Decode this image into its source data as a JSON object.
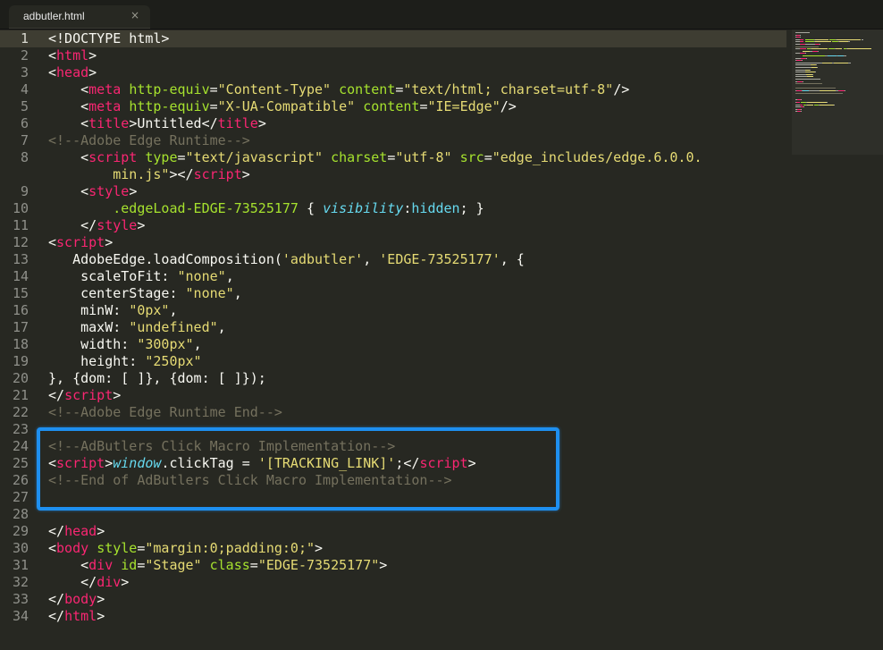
{
  "tab": {
    "title": "adbutler.html",
    "close": "×"
  },
  "code": {
    "line_numbers": [
      "1",
      "2",
      "3",
      "4",
      "5",
      "6",
      "7",
      "8",
      "",
      "9",
      "10",
      "11",
      "12",
      "13",
      "14",
      "15",
      "16",
      "17",
      "18",
      "19",
      "20",
      "21",
      "22",
      "23",
      "24",
      "25",
      "26",
      "27",
      "28",
      "29",
      "30",
      "31",
      "32",
      "33",
      "34"
    ],
    "lines": [
      [
        {
          "t": "<!DOCTYPE html>",
          "c": "plain"
        }
      ],
      [
        {
          "t": "<",
          "c": "plain"
        },
        {
          "t": "html",
          "c": "tag"
        },
        {
          "t": ">",
          "c": "plain"
        }
      ],
      [
        {
          "t": "<",
          "c": "plain"
        },
        {
          "t": "head",
          "c": "tag"
        },
        {
          "t": ">",
          "c": "plain"
        }
      ],
      [
        {
          "t": "    <",
          "c": "plain"
        },
        {
          "t": "meta",
          "c": "tag"
        },
        {
          "t": " ",
          "c": "plain"
        },
        {
          "t": "http-equiv",
          "c": "attr"
        },
        {
          "t": "=",
          "c": "plain"
        },
        {
          "t": "\"Content-Type\"",
          "c": "str"
        },
        {
          "t": " ",
          "c": "plain"
        },
        {
          "t": "content",
          "c": "attr"
        },
        {
          "t": "=",
          "c": "plain"
        },
        {
          "t": "\"text/html; charset=utf-8\"",
          "c": "str"
        },
        {
          "t": "/>",
          "c": "plain"
        }
      ],
      [
        {
          "t": "    <",
          "c": "plain"
        },
        {
          "t": "meta",
          "c": "tag"
        },
        {
          "t": " ",
          "c": "plain"
        },
        {
          "t": "http-equiv",
          "c": "attr"
        },
        {
          "t": "=",
          "c": "plain"
        },
        {
          "t": "\"X-UA-Compatible\"",
          "c": "str"
        },
        {
          "t": " ",
          "c": "plain"
        },
        {
          "t": "content",
          "c": "attr"
        },
        {
          "t": "=",
          "c": "plain"
        },
        {
          "t": "\"IE=Edge\"",
          "c": "str"
        },
        {
          "t": "/>",
          "c": "plain"
        }
      ],
      [
        {
          "t": "    <",
          "c": "plain"
        },
        {
          "t": "title",
          "c": "tag"
        },
        {
          "t": ">Untitled</",
          "c": "plain"
        },
        {
          "t": "title",
          "c": "tag"
        },
        {
          "t": ">",
          "c": "plain"
        }
      ],
      [
        {
          "t": "<!--Adobe Edge Runtime-->",
          "c": "com"
        }
      ],
      [
        {
          "t": "    <",
          "c": "plain"
        },
        {
          "t": "script",
          "c": "tag"
        },
        {
          "t": " ",
          "c": "plain"
        },
        {
          "t": "type",
          "c": "attr"
        },
        {
          "t": "=",
          "c": "plain"
        },
        {
          "t": "\"text/javascript\"",
          "c": "str"
        },
        {
          "t": " ",
          "c": "plain"
        },
        {
          "t": "charset",
          "c": "attr"
        },
        {
          "t": "=",
          "c": "plain"
        },
        {
          "t": "\"utf-8\"",
          "c": "str"
        },
        {
          "t": " ",
          "c": "plain"
        },
        {
          "t": "src",
          "c": "attr"
        },
        {
          "t": "=",
          "c": "plain"
        },
        {
          "t": "\"edge_includes/edge.6.0.0.",
          "c": "str"
        }
      ],
      [
        {
          "t": "        ",
          "c": "plain"
        },
        {
          "t": "min.js\"",
          "c": "str"
        },
        {
          "t": "></",
          "c": "plain"
        },
        {
          "t": "script",
          "c": "tag"
        },
        {
          "t": ">",
          "c": "plain"
        }
      ],
      [
        {
          "t": "    <",
          "c": "plain"
        },
        {
          "t": "style",
          "c": "tag"
        },
        {
          "t": ">",
          "c": "plain"
        }
      ],
      [
        {
          "t": "        ",
          "c": "plain"
        },
        {
          "t": ".edgeLoad-EDGE-73525177",
          "c": "attr"
        },
        {
          "t": " { ",
          "c": "plain"
        },
        {
          "t": "visibility",
          "c": "var"
        },
        {
          "t": ":",
          "c": "plain"
        },
        {
          "t": "hidden",
          "c": "kw"
        },
        {
          "t": "; }",
          "c": "plain"
        }
      ],
      [
        {
          "t": "    </",
          "c": "plain"
        },
        {
          "t": "style",
          "c": "tag"
        },
        {
          "t": ">",
          "c": "plain"
        }
      ],
      [
        {
          "t": "<",
          "c": "plain"
        },
        {
          "t": "script",
          "c": "tag"
        },
        {
          "t": ">",
          "c": "plain"
        }
      ],
      [
        {
          "t": "   AdobeEdge.loadComposition(",
          "c": "plain"
        },
        {
          "t": "'adbutler'",
          "c": "str"
        },
        {
          "t": ", ",
          "c": "plain"
        },
        {
          "t": "'EDGE-73525177'",
          "c": "str"
        },
        {
          "t": ", {",
          "c": "plain"
        }
      ],
      [
        {
          "t": "    scaleToFit: ",
          "c": "plain"
        },
        {
          "t": "\"none\"",
          "c": "str"
        },
        {
          "t": ",",
          "c": "plain"
        }
      ],
      [
        {
          "t": "    centerStage: ",
          "c": "plain"
        },
        {
          "t": "\"none\"",
          "c": "str"
        },
        {
          "t": ",",
          "c": "plain"
        }
      ],
      [
        {
          "t": "    minW: ",
          "c": "plain"
        },
        {
          "t": "\"0px\"",
          "c": "str"
        },
        {
          "t": ",",
          "c": "plain"
        }
      ],
      [
        {
          "t": "    maxW: ",
          "c": "plain"
        },
        {
          "t": "\"undefined\"",
          "c": "str"
        },
        {
          "t": ",",
          "c": "plain"
        }
      ],
      [
        {
          "t": "    width: ",
          "c": "plain"
        },
        {
          "t": "\"300px\"",
          "c": "str"
        },
        {
          "t": ",",
          "c": "plain"
        }
      ],
      [
        {
          "t": "    height: ",
          "c": "plain"
        },
        {
          "t": "\"250px\"",
          "c": "str"
        }
      ],
      [
        {
          "t": "}, {dom: [ ]}, {dom: [ ]});",
          "c": "plain"
        }
      ],
      [
        {
          "t": "</",
          "c": "plain"
        },
        {
          "t": "script",
          "c": "tag"
        },
        {
          "t": ">",
          "c": "plain"
        }
      ],
      [
        {
          "t": "<!--Adobe Edge Runtime End-->",
          "c": "com"
        }
      ],
      [
        {
          "t": "",
          "c": "plain"
        }
      ],
      [
        {
          "t": "<!--AdButlers Click Macro Implementation-->",
          "c": "com"
        }
      ],
      [
        {
          "t": "<",
          "c": "plain"
        },
        {
          "t": "script",
          "c": "tag"
        },
        {
          "t": ">",
          "c": "plain"
        },
        {
          "t": "window",
          "c": "var"
        },
        {
          "t": ".clickTag = ",
          "c": "plain"
        },
        {
          "t": "'[TRACKING_LINK]'",
          "c": "str"
        },
        {
          "t": ";</",
          "c": "plain"
        },
        {
          "t": "script",
          "c": "tag"
        },
        {
          "t": ">",
          "c": "plain"
        }
      ],
      [
        {
          "t": "<!--End of AdButlers Click Macro Implementation-->",
          "c": "com"
        }
      ],
      [
        {
          "t": "",
          "c": "plain"
        }
      ],
      [
        {
          "t": "",
          "c": "plain"
        }
      ],
      [
        {
          "t": "</",
          "c": "plain"
        },
        {
          "t": "head",
          "c": "tag"
        },
        {
          "t": ">",
          "c": "plain"
        }
      ],
      [
        {
          "t": "<",
          "c": "plain"
        },
        {
          "t": "body",
          "c": "tag"
        },
        {
          "t": " ",
          "c": "plain"
        },
        {
          "t": "style",
          "c": "attr"
        },
        {
          "t": "=",
          "c": "plain"
        },
        {
          "t": "\"margin:0;padding:0;\"",
          "c": "str"
        },
        {
          "t": ">",
          "c": "plain"
        }
      ],
      [
        {
          "t": "    <",
          "c": "plain"
        },
        {
          "t": "div",
          "c": "tag"
        },
        {
          "t": " ",
          "c": "plain"
        },
        {
          "t": "id",
          "c": "attr"
        },
        {
          "t": "=",
          "c": "plain"
        },
        {
          "t": "\"Stage\"",
          "c": "str"
        },
        {
          "t": " ",
          "c": "plain"
        },
        {
          "t": "class",
          "c": "attr"
        },
        {
          "t": "=",
          "c": "plain"
        },
        {
          "t": "\"EDGE-73525177\"",
          "c": "str"
        },
        {
          "t": ">",
          "c": "plain"
        }
      ],
      [
        {
          "t": "    </",
          "c": "plain"
        },
        {
          "t": "div",
          "c": "tag"
        },
        {
          "t": ">",
          "c": "plain"
        }
      ],
      [
        {
          "t": "</",
          "c": "plain"
        },
        {
          "t": "body",
          "c": "tag"
        },
        {
          "t": ">",
          "c": "plain"
        }
      ],
      [
        {
          "t": "</",
          "c": "plain"
        },
        {
          "t": "html",
          "c": "tag"
        },
        {
          "t": ">",
          "c": "plain"
        }
      ]
    ]
  },
  "colors": {
    "background": "#272822",
    "tag": "#f92672",
    "attribute": "#a6e22e",
    "string": "#e6db74",
    "comment": "#75715e",
    "keyword": "#66d9ef",
    "highlight_box": "#1e8fef"
  }
}
